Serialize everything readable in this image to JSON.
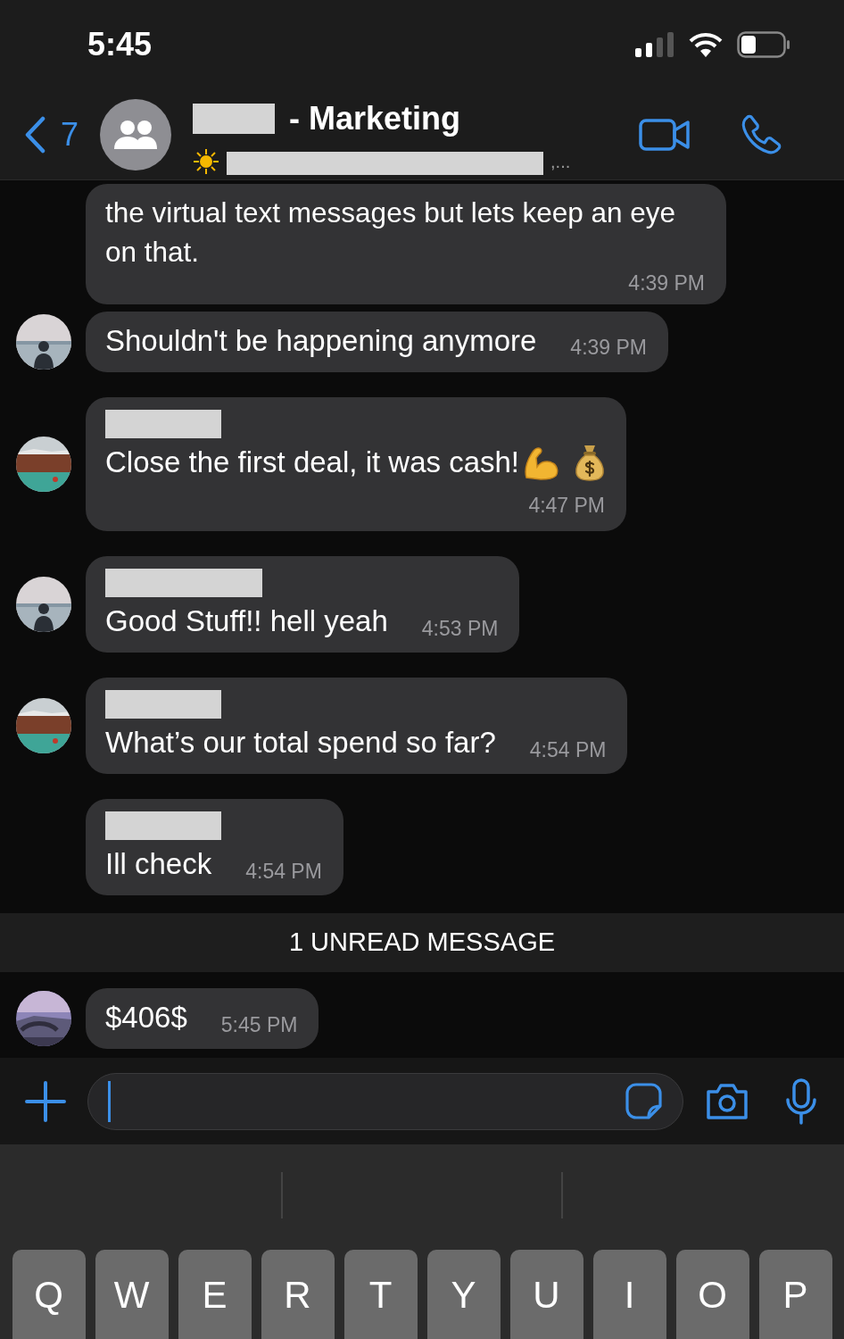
{
  "status_bar": {
    "time": "5:45"
  },
  "header": {
    "back_count": "7",
    "title_hidden": true,
    "title": "- Marketing",
    "subtitle_hidden": true,
    "subtitle_suffix": ",..."
  },
  "chat": [
    {
      "kind": "wrapped",
      "sender_hidden": false,
      "text": "the virtual text messages but lets keep an eye on that.",
      "time": "4:39 PM"
    },
    {
      "kind": "inline",
      "sender_hidden": false,
      "text": "Shouldn't be happening anymore",
      "time": "4:39 PM"
    },
    {
      "kind": "emoji",
      "sender_hidden": true,
      "text": "Close the first deal, it was cash!",
      "time": "4:47 PM"
    },
    {
      "kind": "inline",
      "sender_hidden": true,
      "text": "Good Stuff!! hell yeah",
      "time": "4:53 PM"
    },
    {
      "kind": "inline",
      "sender_hidden": true,
      "text": "What’s our total spend so far?",
      "time": "4:54 PM"
    },
    {
      "kind": "inline",
      "sender_hidden": true,
      "text": "Ill check",
      "time": "4:54 PM"
    },
    {
      "kind": "divider",
      "label": "1 UNREAD MESSAGE"
    },
    {
      "kind": "inline",
      "sender_hidden": false,
      "text": "$406$",
      "time": "5:45 PM"
    }
  ],
  "keyboard": {
    "keys": [
      "Q",
      "W",
      "E",
      "R",
      "T",
      "Y",
      "U",
      "I",
      "O",
      "P"
    ]
  }
}
